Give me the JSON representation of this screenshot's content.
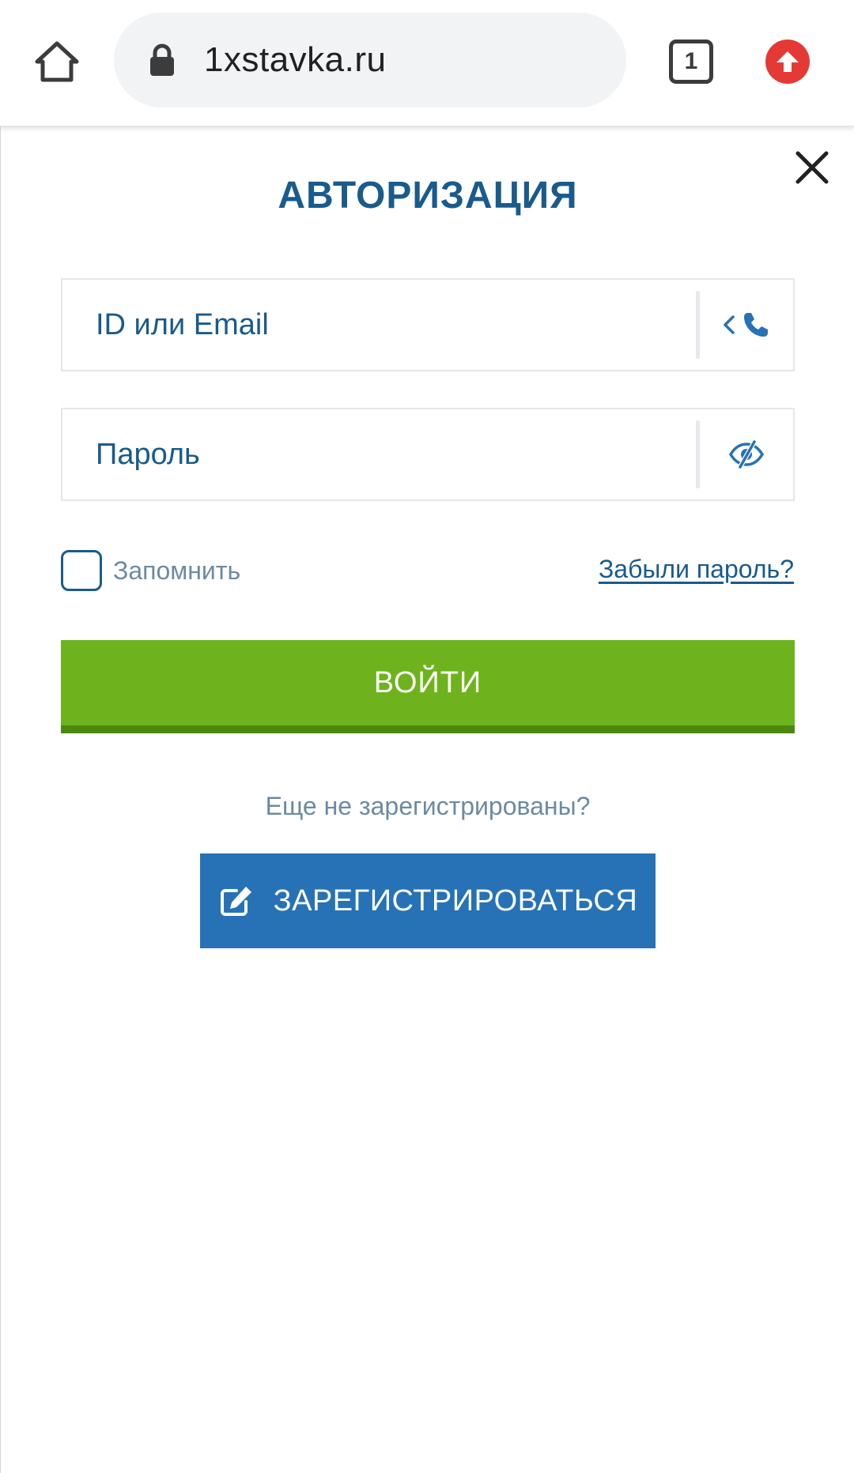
{
  "browser": {
    "url": "1xstavka.ru",
    "tab_count": "1",
    "icons": {
      "home": "home-icon",
      "lock": "lock-icon",
      "tabs": "tabs-icon",
      "update": "update-arrow-icon"
    }
  },
  "modal": {
    "title": "АВТОРИЗАЦИЯ",
    "close_icon": "close-icon",
    "login_field": {
      "placeholder": "ID или Email",
      "value": "",
      "icons": [
        "chevron-left-icon",
        "phone-icon"
      ]
    },
    "password_field": {
      "placeholder": "Пароль",
      "value": "",
      "icon": "eye-slash-icon"
    },
    "remember_label": "Запомнить",
    "remember_checked": false,
    "forgot_link": "Забыли пароль?",
    "login_button": "ВОЙТИ",
    "not_registered_text": "Еще не зарегистрированы?",
    "register_button": "ЗАРЕГИСТРИРОВАТЬСЯ",
    "register_icon": "edit-icon"
  },
  "colors": {
    "primary_blue": "#195b8c",
    "button_blue": "#2772b6",
    "button_green": "#6eb31e",
    "button_green_shadow": "#4c8810",
    "muted_text": "#6c8aa3",
    "update_red": "#e53935"
  }
}
